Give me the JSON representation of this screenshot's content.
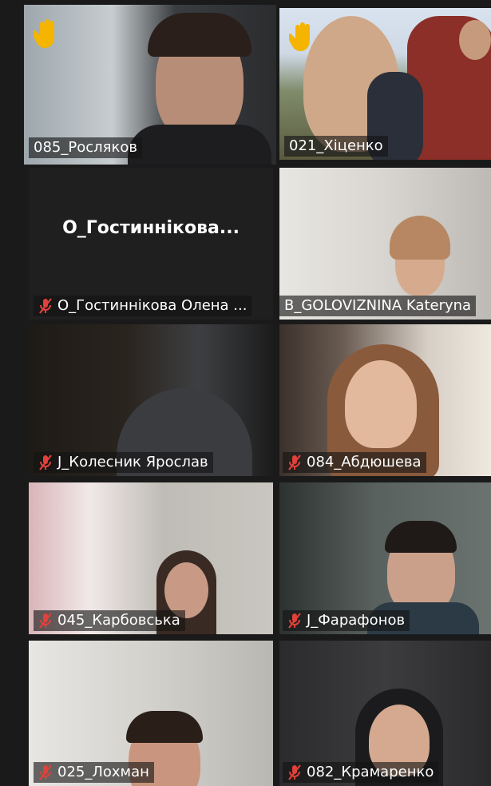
{
  "participants": [
    {
      "name": "085_Росляков",
      "muted": false,
      "hand_raised": true,
      "video": true,
      "active_speaker": true
    },
    {
      "name": "021_Хіценко",
      "muted": false,
      "hand_raised": true,
      "video": true,
      "active_speaker": false
    },
    {
      "name": "О_Гостиннікова Олена ...",
      "center_label": "О_Гостиннікова...",
      "muted": true,
      "hand_raised": false,
      "video": false,
      "active_speaker": false
    },
    {
      "name": "B_GOLOVIZNINA Kateryna",
      "muted": false,
      "hand_raised": false,
      "video": true,
      "active_speaker": false
    },
    {
      "name": "J_Колесник Ярослав",
      "muted": true,
      "hand_raised": false,
      "video": true,
      "active_speaker": false
    },
    {
      "name": "084_Абдюшева",
      "muted": true,
      "hand_raised": false,
      "video": true,
      "active_speaker": false
    },
    {
      "name": "045_Карбовська",
      "muted": true,
      "hand_raised": false,
      "video": true,
      "active_speaker": false
    },
    {
      "name": "J_Фарафонов",
      "muted": true,
      "hand_raised": false,
      "video": true,
      "active_speaker": false
    },
    {
      "name": "025_Лохман",
      "muted": true,
      "hand_raised": false,
      "video": true,
      "active_speaker": false
    },
    {
      "name": "082_Крамаренко",
      "muted": true,
      "hand_raised": false,
      "video": true,
      "active_speaker": false
    }
  ],
  "colors": {
    "active_border": "#c9e36f",
    "muted_icon": "#e0413a",
    "hand_icon": "#f4b400"
  },
  "icons": {
    "hand": "raised-hand-icon",
    "mic_muted": "mic-muted-icon"
  }
}
